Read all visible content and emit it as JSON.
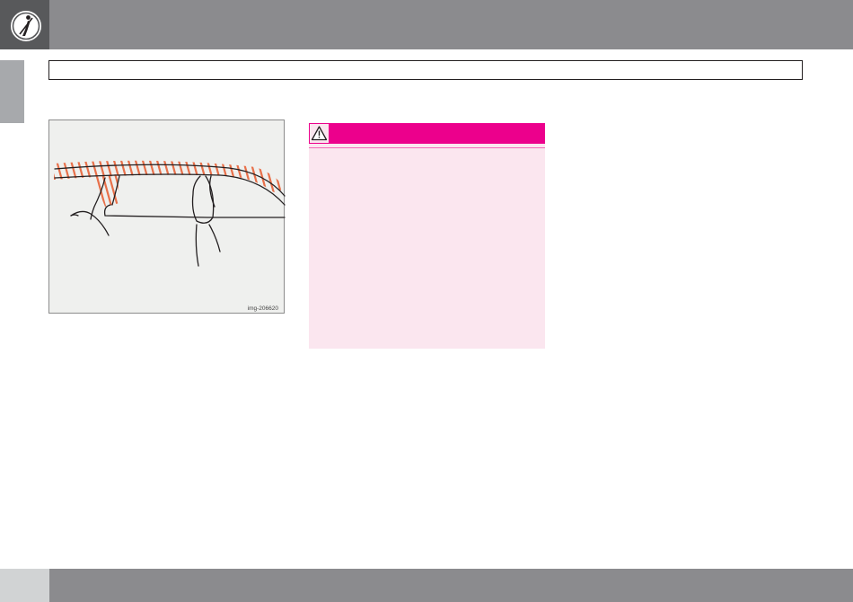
{
  "header": {
    "icon": "seatbelt-icon",
    "colors": {
      "corner": "#58595b",
      "band": "#8b8b8e"
    }
  },
  "title_box": {
    "text": ""
  },
  "illustration": {
    "image_code": "img-206620",
    "highlight_color": "#e8704a"
  },
  "warning": {
    "icon": "warning-triangle-icon",
    "colors": {
      "header": "#ec008c",
      "background": "#fbe6ef"
    }
  },
  "footer": {
    "colors": {
      "corner": "#d1d3d4",
      "band": "#8b8b8e"
    }
  }
}
